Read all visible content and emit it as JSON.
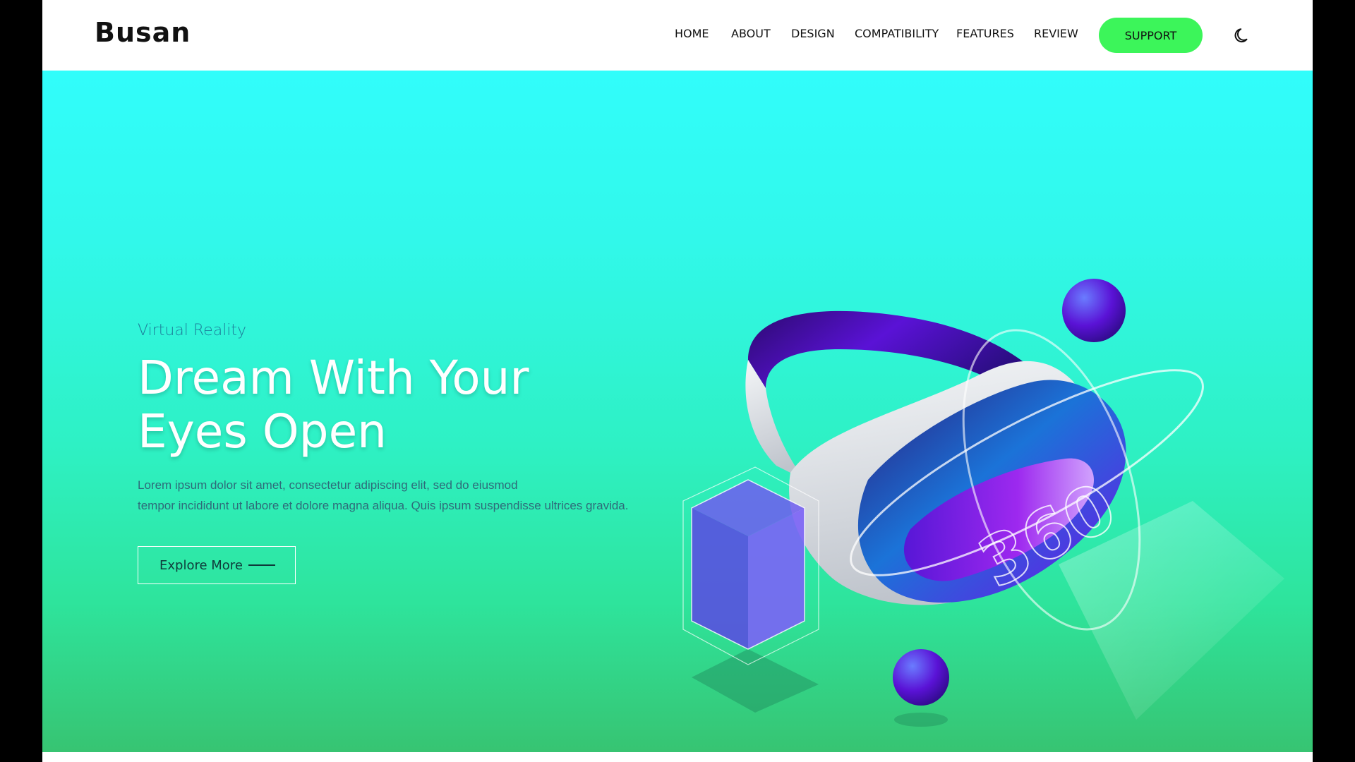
{
  "brand": {
    "logo_text": "Busan"
  },
  "nav": {
    "items": [
      {
        "label": "HOME"
      },
      {
        "label": "ABOUT"
      },
      {
        "label": "DESIGN"
      },
      {
        "label": "COMPATIBILITY"
      },
      {
        "label": "FEATURES"
      },
      {
        "label": "REVIEW"
      }
    ],
    "support_label": "SUPPORT",
    "theme_toggle_icon": "moon-icon"
  },
  "hero": {
    "subtitle": "Virtual Reality",
    "headline": "Dream With Your Eyes Open",
    "description_line1": "Lorem ipsum dolor sit amet, consectetur adipiscing elit, sed do eiusmod",
    "description_line2": "tempor incididunt ut labore et dolore magna aliqua. Quis ipsum suspendisse ultrices gravida.",
    "cta_label": "Explore More",
    "illustration_text": "360"
  },
  "colors": {
    "support_button": "#3cf55a",
    "hero_top": "#31fdfb",
    "hero_bottom": "#37c472",
    "headset_purple": "#5a12d6"
  }
}
